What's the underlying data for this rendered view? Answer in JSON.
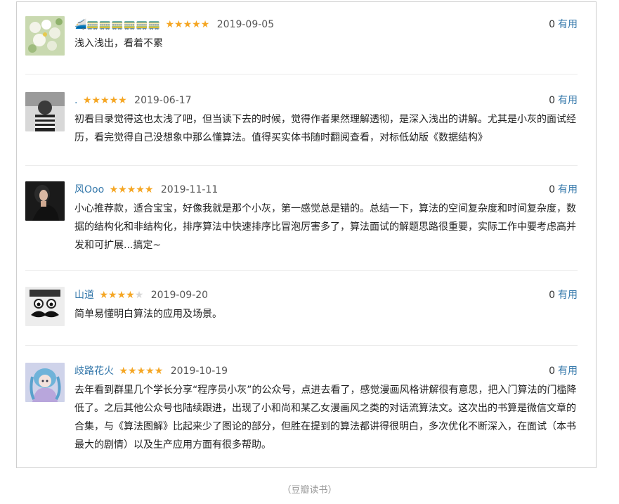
{
  "reviews": [
    {
      "username": "🚄🚃🚃🚃🚃🚃🚃",
      "stars": 5,
      "date": "2019-09-05",
      "useful_count": "0",
      "useful_label": "有用",
      "text": "浅入浅出，看着不累",
      "avatar_icon": "flower-avatar-icon"
    },
    {
      "username": ".",
      "stars": 5,
      "date": "2019-06-17",
      "useful_count": "0",
      "useful_label": "有用",
      "text": "初看目录觉得这也太浅了吧，但当读下去的时候，觉得作者果然理解透彻，是深入浅出的讲解。尤其是小灰的面试经历，看完觉得自己没想象中那么懂算法。值得买实体书随时翻阅查看，对标低幼版《数据结构》",
      "avatar_icon": "person-bw-avatar-icon"
    },
    {
      "username": "风Ooo",
      "stars": 5,
      "date": "2019-11-11",
      "useful_count": "0",
      "useful_label": "有用",
      "text": "小心推荐款，适合宝宝，好像我就是那个小灰，第一感觉总是错的。总结一下，算法的空间复杂度和时间复杂度，数据的结构化和非结构化，排序算法中快速排序比冒泡厉害多了，算法面试的解题思路很重要，实际工作中要考虑高并发和可扩展...搞定~",
      "avatar_icon": "woman-avatar-icon"
    },
    {
      "username": "山道",
      "stars": 4,
      "date": "2019-09-20",
      "useful_count": "0",
      "useful_label": "有用",
      "text": "简单易懂明白算法的应用及场景。",
      "avatar_icon": "mustache-face-avatar-icon"
    },
    {
      "username": "歧路花火",
      "stars": 5,
      "date": "2019-10-19",
      "useful_count": "0",
      "useful_label": "有用",
      "text": "去年看到群里几个学长分享“程序员小灰”的公众号，点进去看了，感觉漫画风格讲解很有意思，把入门算法的门槛降低了。之后其他公众号也陆续跟进，出现了小和尚和某乙女漫画风之类的对话流算法文。这次出的书算是微信文章的合集，与《算法图解》比起来少了图论的部分，但胜在提到的算法都讲得很明白，多次优化不断深入，在面试（本书最大的剧情）以及生产应用方面有很多帮助。",
      "avatar_icon": "anime-girl-avatar-icon"
    }
  ],
  "caption": "（豆瓣读书）",
  "colors": {
    "username": "#3377aa",
    "star": "#f5a623",
    "star_empty": "#d6d6d6",
    "divider": "#ececec"
  }
}
